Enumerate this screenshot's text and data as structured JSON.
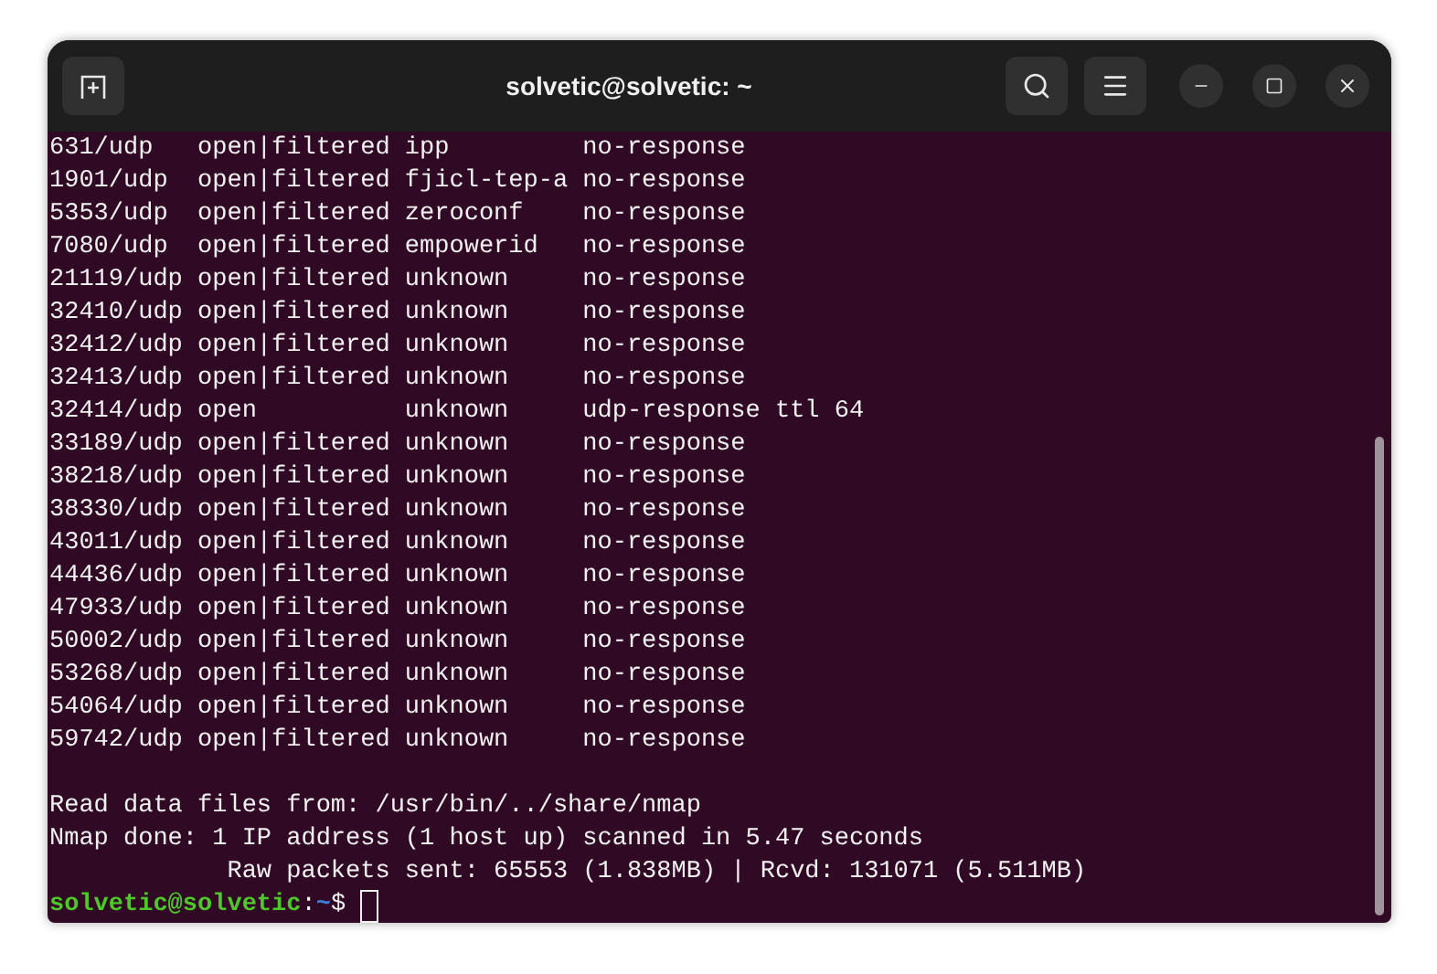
{
  "window": {
    "title": "solvetic@solvetic: ~"
  },
  "output": [
    "631/udp   open|filtered ipp         no-response",
    "1901/udp  open|filtered fjicl-tep-a no-response",
    "5353/udp  open|filtered zeroconf    no-response",
    "7080/udp  open|filtered empowerid   no-response",
    "21119/udp open|filtered unknown     no-response",
    "32410/udp open|filtered unknown     no-response",
    "32412/udp open|filtered unknown     no-response",
    "32413/udp open|filtered unknown     no-response",
    "32414/udp open          unknown     udp-response ttl 64",
    "33189/udp open|filtered unknown     no-response",
    "38218/udp open|filtered unknown     no-response",
    "38330/udp open|filtered unknown     no-response",
    "43011/udp open|filtered unknown     no-response",
    "44436/udp open|filtered unknown     no-response",
    "47933/udp open|filtered unknown     no-response",
    "50002/udp open|filtered unknown     no-response",
    "53268/udp open|filtered unknown     no-response",
    "54064/udp open|filtered unknown     no-response",
    "59742/udp open|filtered unknown     no-response"
  ],
  "summary": [
    "Read data files from: /usr/bin/../share/nmap",
    "Nmap done: 1 IP address (1 host up) scanned in 5.47 seconds",
    "            Raw packets sent: 65553 (1.838MB) | Rcvd: 131071 (5.511MB)"
  ],
  "prompt": {
    "user_host": "solvetic@solvetic",
    "separator": ":",
    "path": "~",
    "symbol": "$"
  }
}
